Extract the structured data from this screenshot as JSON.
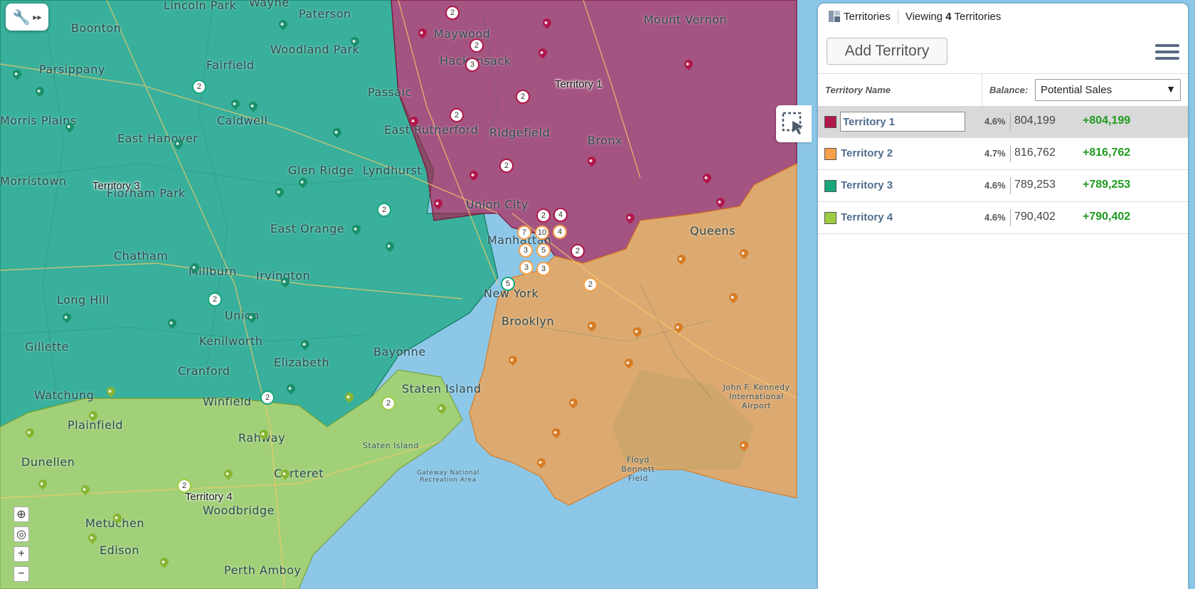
{
  "map": {
    "territory_labels": [
      "Territory 1",
      "Territory 2",
      "Territory 3",
      "Territory 4"
    ],
    "place_labels": [
      "Lincoln Park",
      "Wayne",
      "Paterson",
      "Boonton",
      "Woodland Park",
      "Parsippany",
      "Fairfield",
      "Passaic",
      "Maywood",
      "Hackensack",
      "Mount Vernon",
      "Morris Plains",
      "Caldwell",
      "East Hanover",
      "East Rutherford",
      "Ridgefield",
      "Bronx",
      "Morristown",
      "Florham Park",
      "Glen Ridge",
      "Lyndhurst",
      "Union City",
      "East Orange",
      "Queens",
      "Chatham",
      "Millburn",
      "Irvington",
      "Manhattan",
      "New York",
      "Long Hill",
      "Union",
      "Brooklyn",
      "Kenilworth",
      "Gillette",
      "Bayonne",
      "Cranford",
      "Elizabeth",
      "Watchung",
      "Winfield",
      "Staten Island",
      "Plainfield",
      "Rahway",
      "Dunellen",
      "Carteret",
      "Metuchen",
      "Woodbridge",
      "Edison",
      "Perth Amboy"
    ],
    "small_labels": [
      "John F. Kennedy International Airport",
      "Floyd Bennett Field",
      "Gateway National Recreation Area",
      "Staten Island"
    ],
    "clusters": [
      "2",
      "2",
      "3",
      "2",
      "2",
      "2",
      "2",
      "2",
      "2",
      "2",
      "4",
      "7",
      "10",
      "4",
      "3",
      "5",
      "3",
      "3",
      "2",
      "5",
      "2",
      "2",
      "2",
      "2"
    ]
  },
  "toolbar": {
    "tool_icon": "wrench-icon"
  },
  "zoom": {
    "zoom_area": "⊕",
    "locate": "◎",
    "zoom_in": "+",
    "zoom_out": "−"
  },
  "panel": {
    "title": "Territories",
    "viewing_prefix": "Viewing ",
    "viewing_count": "4",
    "viewing_suffix": " Territories",
    "add_button": "Add Territory",
    "col_name": "Territory Name",
    "balance_label": "Balance:",
    "balance_value": "Potential Sales",
    "rows": [
      {
        "name": "Territory 1",
        "color": "#b0174a",
        "pct": "4.6%",
        "value": "804,199",
        "delta": "+804,199"
      },
      {
        "name": "Territory 2",
        "color": "#f7a04a",
        "pct": "4.7%",
        "value": "816,762",
        "delta": "+816,762"
      },
      {
        "name": "Territory 3",
        "color": "#18a77d",
        "pct": "4.6%",
        "value": "789,253",
        "delta": "+789,253"
      },
      {
        "name": "Territory 4",
        "color": "#9ccc3f",
        "pct": "4.6%",
        "value": "790,402",
        "delta": "+790,402"
      }
    ]
  }
}
